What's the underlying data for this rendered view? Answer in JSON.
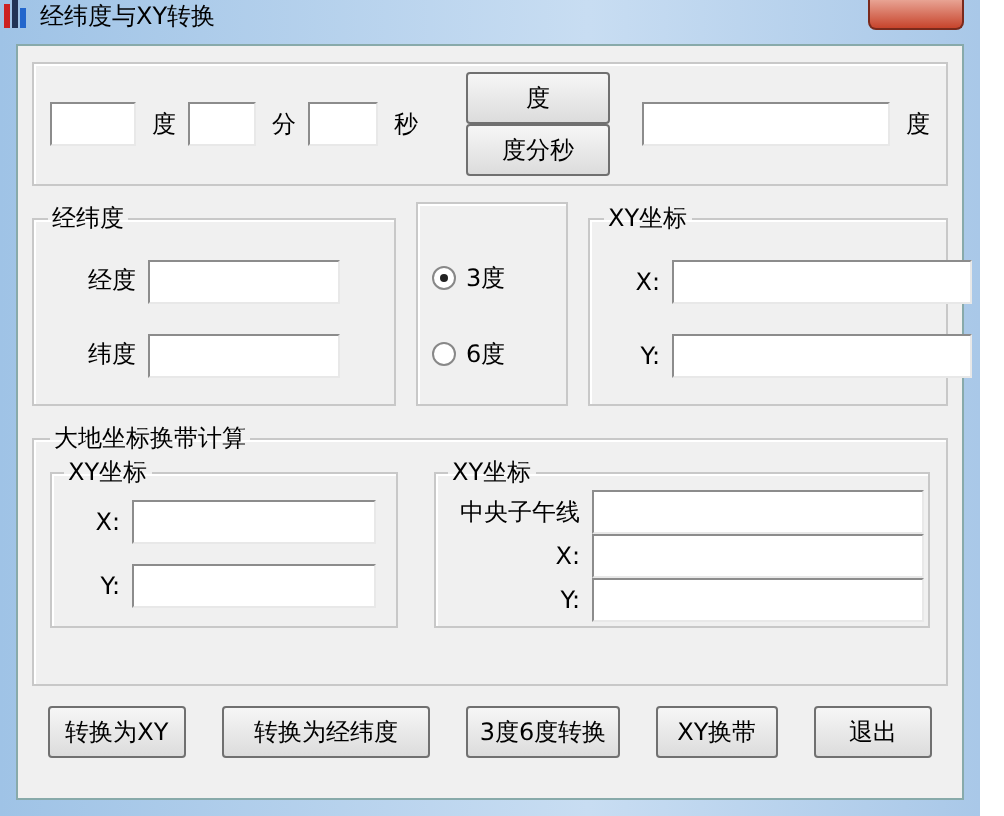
{
  "window": {
    "title": "经纬度与XY转换"
  },
  "dms": {
    "degree_unit": "度",
    "minute_unit": "分",
    "second_unit": "秒",
    "buttons": [
      "度",
      "度分秒"
    ],
    "result_unit": "度"
  },
  "latlon_group": {
    "title": "经纬度",
    "fields": [
      {
        "label": "经度"
      },
      {
        "label": "纬度"
      }
    ]
  },
  "zone_options": [
    {
      "label": "3度",
      "selected": true
    },
    {
      "label": "6度",
      "selected": false
    }
  ],
  "xy_group": {
    "title": "XY坐标",
    "fields": [
      {
        "label": "X:"
      },
      {
        "label": "Y:"
      }
    ]
  },
  "zone_calc": {
    "title": "大地坐标换带计算",
    "left": {
      "title": "XY坐标",
      "fields": [
        {
          "label": "X:"
        },
        {
          "label": "Y:"
        }
      ]
    },
    "right": {
      "title": "XY坐标",
      "fields": [
        {
          "label": "中央子午线"
        },
        {
          "label": "X:"
        },
        {
          "label": "Y:"
        }
      ]
    }
  },
  "buttons": [
    "转换为XY",
    "转换为经纬度",
    "3度6度转换",
    "XY换带",
    "退出"
  ]
}
